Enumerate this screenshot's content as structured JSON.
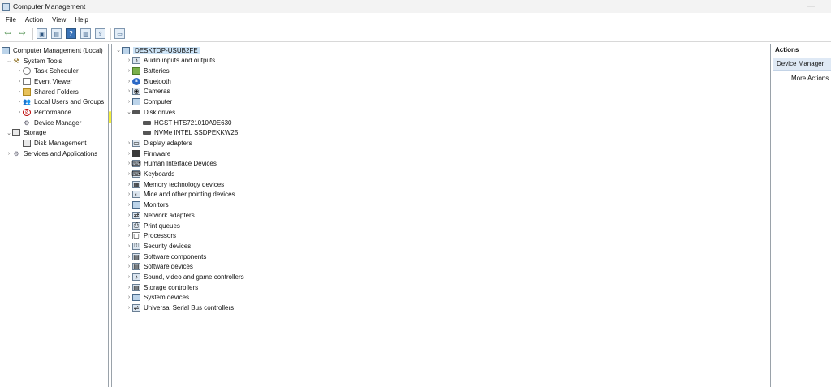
{
  "window": {
    "title": "Computer Management",
    "minimize": "—"
  },
  "menu": [
    "File",
    "Action",
    "View",
    "Help"
  ],
  "toolbar": [
    {
      "name": "back-icon",
      "glyph": "⇦"
    },
    {
      "name": "forward-icon",
      "glyph": "⇨"
    },
    {
      "name": "up-folder-icon",
      "glyph": "▣"
    },
    {
      "name": "show-hide-tree-icon",
      "glyph": "▤"
    },
    {
      "name": "help-icon",
      "glyph": "?"
    },
    {
      "name": "properties-icon",
      "glyph": "▥"
    },
    {
      "name": "export-icon",
      "glyph": "⇪"
    },
    {
      "name": "monitor-icon",
      "glyph": "▭"
    }
  ],
  "left_tree": [
    {
      "label": "Computer Management (Local)",
      "indent": 0,
      "chevron": "",
      "icon": "i-comp",
      "glyph": ""
    },
    {
      "label": "System Tools",
      "indent": 1,
      "chevron": "⌄",
      "icon": "i-tool",
      "glyph": "⚒"
    },
    {
      "label": "Task Scheduler",
      "indent": 2,
      "chevron": "›",
      "icon": "i-clock",
      "glyph": ""
    },
    {
      "label": "Event Viewer",
      "indent": 2,
      "chevron": "›",
      "icon": "i-log",
      "glyph": ""
    },
    {
      "label": "Shared Folders",
      "indent": 2,
      "chevron": "›",
      "icon": "i-folder",
      "glyph": ""
    },
    {
      "label": "Local Users and Groups",
      "indent": 2,
      "chevron": "›",
      "icon": "i-users",
      "glyph": "👥"
    },
    {
      "label": "Performance",
      "indent": 2,
      "chevron": "›",
      "icon": "i-perf",
      "glyph": "⊘"
    },
    {
      "label": "Device Manager",
      "indent": 2,
      "chevron": "",
      "icon": "i-dev",
      "glyph": "⚙",
      "selected": true
    },
    {
      "label": "Storage",
      "indent": 1,
      "chevron": "⌄",
      "icon": "i-stor",
      "glyph": ""
    },
    {
      "label": "Disk Management",
      "indent": 2,
      "chevron": "",
      "icon": "i-stor",
      "glyph": ""
    },
    {
      "label": "Services and Applications",
      "indent": 1,
      "chevron": "›",
      "icon": "i-svc",
      "glyph": "⚙"
    }
  ],
  "device_root": "DESKTOP-USUB2FE",
  "device_tree": [
    {
      "label": "Audio inputs and outputs",
      "indent": 1,
      "chevron": "›",
      "icon": "i-gen",
      "glyph": "♪"
    },
    {
      "label": "Batteries",
      "indent": 1,
      "chevron": "›",
      "icon": "i-green",
      "glyph": ""
    },
    {
      "label": "Bluetooth",
      "indent": 1,
      "chevron": "›",
      "icon": "i-blue",
      "glyph": "ʙ"
    },
    {
      "label": "Cameras",
      "indent": 1,
      "chevron": "›",
      "icon": "i-gen",
      "glyph": "◉"
    },
    {
      "label": "Computer",
      "indent": 1,
      "chevron": "›",
      "icon": "i-comp",
      "glyph": ""
    },
    {
      "label": "Disk drives",
      "indent": 1,
      "chevron": "⌄",
      "icon": "i-disk",
      "glyph": ""
    },
    {
      "label": "HGST HTS721010A9E630",
      "indent": 2,
      "chevron": "",
      "icon": "i-disk",
      "glyph": ""
    },
    {
      "label": "NVMe INTEL SSDPEKKW25",
      "indent": 2,
      "chevron": "",
      "icon": "i-disk",
      "glyph": ""
    },
    {
      "label": "Display adapters",
      "indent": 1,
      "chevron": "›",
      "icon": "i-gen",
      "glyph": "▭"
    },
    {
      "label": "Firmware",
      "indent": 1,
      "chevron": "›",
      "icon": "i-dark",
      "glyph": ""
    },
    {
      "label": "Human Interface Devices",
      "indent": 1,
      "chevron": "›",
      "icon": "i-gen",
      "glyph": "⌨"
    },
    {
      "label": "Keyboards",
      "indent": 1,
      "chevron": "›",
      "icon": "i-gen",
      "glyph": "⌨"
    },
    {
      "label": "Memory technology devices",
      "indent": 1,
      "chevron": "›",
      "icon": "i-gen",
      "glyph": "▦"
    },
    {
      "label": "Mice and other pointing devices",
      "indent": 1,
      "chevron": "›",
      "icon": "i-gen",
      "glyph": "◐"
    },
    {
      "label": "Monitors",
      "indent": 1,
      "chevron": "›",
      "icon": "i-comp",
      "glyph": ""
    },
    {
      "label": "Network adapters",
      "indent": 1,
      "chevron": "›",
      "icon": "i-gen",
      "glyph": "⇄"
    },
    {
      "label": "Print queues",
      "indent": 1,
      "chevron": "›",
      "icon": "i-gen",
      "glyph": "⎙"
    },
    {
      "label": "Processors",
      "indent": 1,
      "chevron": "›",
      "icon": "i-log",
      "glyph": "▢"
    },
    {
      "label": "Security devices",
      "indent": 1,
      "chevron": "›",
      "icon": "i-gen",
      "glyph": "⚿"
    },
    {
      "label": "Software components",
      "indent": 1,
      "chevron": "›",
      "icon": "i-gen",
      "glyph": "▤"
    },
    {
      "label": "Software devices",
      "indent": 1,
      "chevron": "›",
      "icon": "i-gen",
      "glyph": "▤"
    },
    {
      "label": "Sound, video and game controllers",
      "indent": 1,
      "chevron": "›",
      "icon": "i-gen",
      "glyph": "♪"
    },
    {
      "label": "Storage controllers",
      "indent": 1,
      "chevron": "›",
      "icon": "i-gen",
      "glyph": "▤"
    },
    {
      "label": "System devices",
      "indent": 1,
      "chevron": "›",
      "icon": "i-comp",
      "glyph": ""
    },
    {
      "label": "Universal Serial Bus controllers",
      "indent": 1,
      "chevron": "›",
      "icon": "i-gen",
      "glyph": "⇌"
    }
  ],
  "actions": {
    "header": "Actions",
    "selected": "Device Manager",
    "more": "More Actions"
  },
  "colors": {
    "highlight": "#f3ef2e",
    "selection": "#cde4f7"
  }
}
